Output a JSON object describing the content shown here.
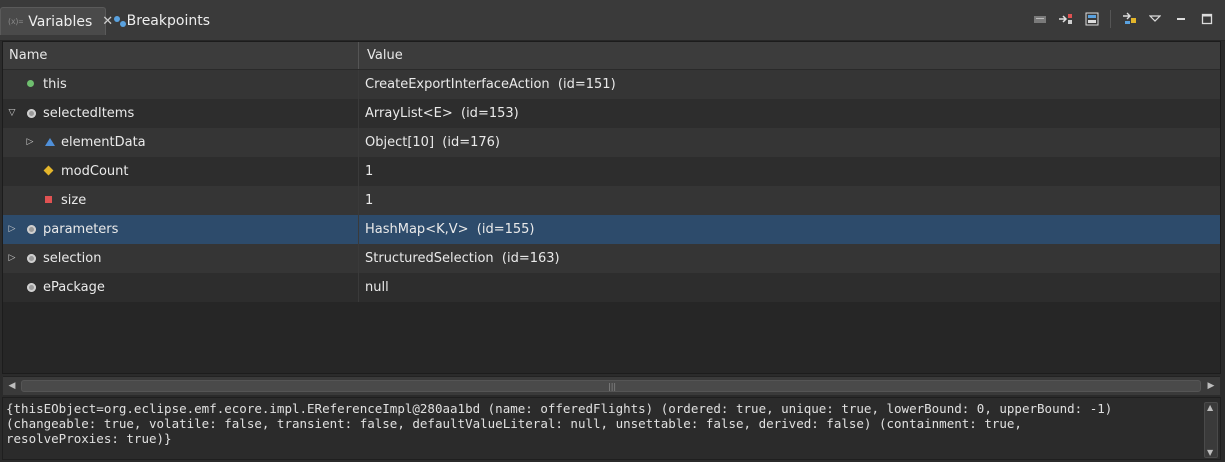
{
  "tabs": [
    {
      "label": "Variables",
      "icon": "variables-icon",
      "active": true,
      "icon_text": "(x)="
    },
    {
      "label": "Breakpoints",
      "icon": "breakpoints-icon",
      "active": false
    }
  ],
  "toolbar": {
    "items": [
      "show-type-names-icon",
      "collapse-all-icon",
      "layout-icon",
      "select-columns-icon",
      "view-menu-icon",
      "minimize-icon",
      "maximize-icon"
    ]
  },
  "table": {
    "columns": {
      "name": "Name",
      "value": "Value"
    },
    "rows": [
      {
        "name": "this",
        "value": "CreateExportInterfaceAction  (id=151)",
        "depth": 0,
        "expand": "none",
        "icon": "local-variable-icon"
      },
      {
        "name": "selectedItems",
        "value": "ArrayList<E>  (id=153)",
        "depth": 0,
        "expand": "expanded",
        "icon": "field-icon"
      },
      {
        "name": "elementData",
        "value": "Object[10]  (id=176)",
        "depth": 1,
        "expand": "collapsed",
        "icon": "protected-field-icon"
      },
      {
        "name": "modCount",
        "value": "1",
        "depth": 1,
        "expand": "none",
        "icon": "default-field-icon"
      },
      {
        "name": "size",
        "value": "1",
        "depth": 1,
        "expand": "none",
        "icon": "private-field-icon"
      },
      {
        "name": "parameters",
        "value": "HashMap<K,V>  (id=155)",
        "depth": 0,
        "expand": "collapsed",
        "icon": "field-icon",
        "selected": true
      },
      {
        "name": "selection",
        "value": "StructuredSelection  (id=163)",
        "depth": 0,
        "expand": "collapsed",
        "icon": "field-icon"
      },
      {
        "name": "ePackage",
        "value": "null",
        "depth": 0,
        "expand": "none",
        "icon": "field-icon"
      }
    ]
  },
  "details": {
    "text": "{thisEObject=org.eclipse.emf.ecore.impl.EReferenceImpl@280aa1bd (name: offeredFlights) (ordered: true, unique: true, lowerBound: 0, upperBound: -1)\n(changeable: true, volatile: false, transient: false, defaultValueLiteral: null, unsettable: false, derived: false) (containment: true,\nresolveProxies: true)}"
  }
}
